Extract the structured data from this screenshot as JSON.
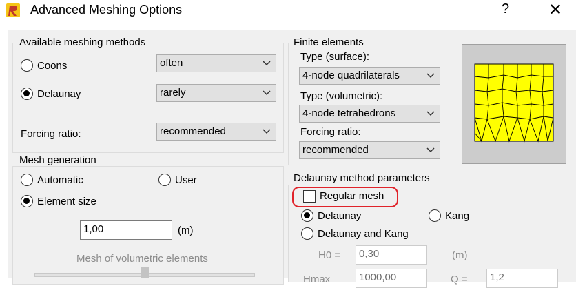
{
  "window": {
    "title": "Advanced Meshing Options",
    "help_glyph": "?",
    "close_glyph": "✕"
  },
  "meshing_methods": {
    "legend": "Available meshing methods",
    "coons_label": "Coons",
    "coons_value": "often",
    "delaunay_label": "Delaunay",
    "delaunay_value": "rarely",
    "forcing_label": "Forcing ratio:",
    "forcing_value": "recommended",
    "selected": "delaunay"
  },
  "finite_elements": {
    "legend": "Finite elements",
    "surface_label": "Type (surface):",
    "surface_value": "4-node quadrilaterals",
    "volumetric_label": "Type (volumetric):",
    "volumetric_value": "4-node tetrahedrons",
    "forcing_label": "Forcing ratio:",
    "forcing_value": "recommended"
  },
  "mesh_generation": {
    "legend": "Mesh generation",
    "automatic_label": "Automatic",
    "user_label": "User",
    "element_size_label": "Element size",
    "selected": "element_size",
    "element_size_value": "1,00",
    "element_size_unit": "(m)",
    "volumetric_label": "Mesh of volumetric elements"
  },
  "delaunay_params": {
    "legend": "Delaunay method parameters",
    "regular_mesh_label": "Regular mesh",
    "regular_mesh_checked": false,
    "delaunay_label": "Delaunay",
    "kang_label": "Kang",
    "delaunay_and_kang_label": "Delaunay and Kang",
    "selected": "delaunay",
    "h0_label": "H0 =",
    "h0_value": "0,30",
    "h0_unit": "(m)",
    "hmax_label": "Hmax",
    "hmax_value": "1000,00",
    "q_label": "Q =",
    "q_value": "1,2"
  },
  "colors": {
    "mesh_fill": "#ffff00",
    "highlight": "#e0232a"
  }
}
